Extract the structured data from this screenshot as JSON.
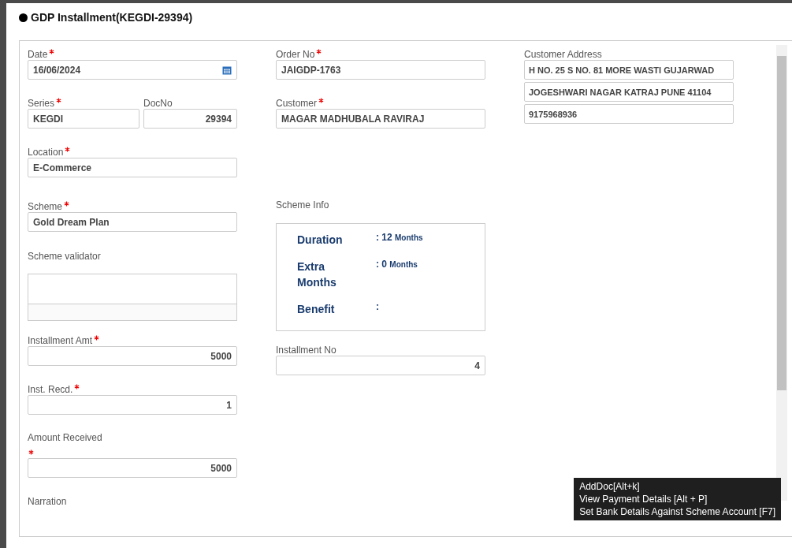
{
  "dialog": {
    "title": "GDP Installment(KEGDI-29394)"
  },
  "date": {
    "label": "Date",
    "required": true,
    "value": "16/06/2024"
  },
  "series": {
    "label": "Series",
    "required": true,
    "value": "KEGDI"
  },
  "doc_no": {
    "label": "DocNo",
    "required": false,
    "value": "29394"
  },
  "location": {
    "label": "Location",
    "required": true,
    "value": "E-Commerce"
  },
  "scheme": {
    "label": "Scheme",
    "required": true,
    "value": "Gold Dream Plan"
  },
  "scheme_validator": {
    "label": "Scheme validator"
  },
  "installment_amt": {
    "label": "Installment Amt",
    "required": true,
    "value": "5000"
  },
  "inst_recd": {
    "label": "Inst. Recd.",
    "required": true,
    "value": "1"
  },
  "amount_received": {
    "label": "Amount Received",
    "required": true,
    "value": "5000"
  },
  "narration": {
    "label": "Narration"
  },
  "order_no": {
    "label": "Order No",
    "required": true,
    "value": "JAIGDP-1763"
  },
  "customer": {
    "label": "Customer",
    "required": true,
    "value": "MAGAR MADHUBALA RAVIRAJ"
  },
  "scheme_info": {
    "label": "Scheme Info",
    "rows": [
      {
        "label": "Duration",
        "value": ": 12",
        "unit": "Months"
      },
      {
        "label": "Extra Months",
        "value": ": 0",
        "unit": "Months"
      },
      {
        "label": "Benefit",
        "value": ":"
      }
    ]
  },
  "installment_no": {
    "label": "Installment No",
    "required": false,
    "value": "4"
  },
  "customer_address": {
    "label": "Customer Address",
    "lines": [
      "H NO. 25 S NO. 81 MORE WASTI GUJARWAD",
      "JOGESHWARI NAGAR KATRAJ PUNE 41104",
      "9175968936"
    ]
  },
  "tooltip": {
    "lines": [
      "AddDoc[Alt+k]",
      "View Payment Details [Alt + P]",
      "Set Bank Details Against Scheme Account [F7]"
    ]
  }
}
